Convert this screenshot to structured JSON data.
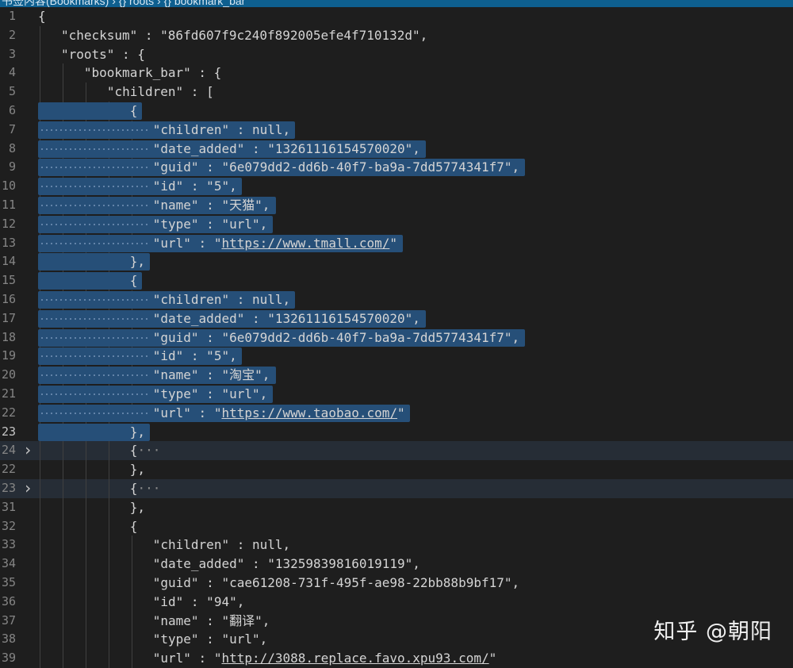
{
  "header": {
    "crumb": "书签内容(Bookmarks) › {} roots › {} bookmark_bar"
  },
  "watermark": "知乎 @朝阳",
  "lines": [
    {
      "n": "1",
      "indent": 0,
      "text": "{"
    },
    {
      "n": "2",
      "indent": 1,
      "text": "\"checksum\" : \"86fd607f9c240f892005efe4f710132d\","
    },
    {
      "n": "3",
      "indent": 1,
      "text": "\"roots\" : {"
    },
    {
      "n": "4",
      "indent": 2,
      "text": "\"bookmark_bar\" : {"
    },
    {
      "n": "5",
      "indent": 3,
      "text": "\"children\" : ["
    },
    {
      "n": "6",
      "indent": 4,
      "text": "{",
      "sel": true
    },
    {
      "n": "7",
      "indent": 5,
      "text": "\"children\" : null,",
      "sel": true
    },
    {
      "n": "8",
      "indent": 5,
      "text": "\"date_added\" : \"13261116154570020\",",
      "sel": true
    },
    {
      "n": "9",
      "indent": 5,
      "text": "\"guid\" : \"6e079dd2-dd6b-40f7-ba9a-7dd5774341f7\",",
      "sel": true
    },
    {
      "n": "10",
      "indent": 5,
      "text": "\"id\" : \"5\",",
      "sel": true
    },
    {
      "n": "11",
      "indent": 5,
      "text": "\"name\" : \"天猫\",",
      "sel": true
    },
    {
      "n": "12",
      "indent": 5,
      "text": "\"type\" : \"url\",",
      "sel": true
    },
    {
      "n": "13",
      "indent": 5,
      "text": "\"url\" : \"https://www.tmall.com/\"",
      "sel": true
    },
    {
      "n": "14",
      "indent": 4,
      "text": "},",
      "sel": true
    },
    {
      "n": "15",
      "indent": 4,
      "text": "{",
      "sel": true
    },
    {
      "n": "16",
      "indent": 5,
      "text": "\"children\" : null,",
      "sel": true
    },
    {
      "n": "17",
      "indent": 5,
      "text": "\"date_added\" : \"13261116154570020\",",
      "sel": true
    },
    {
      "n": "18",
      "indent": 5,
      "text": "\"guid\" : \"6e079dd2-dd6b-40f7-ba9a-7dd5774341f7\",",
      "sel": true
    },
    {
      "n": "19",
      "indent": 5,
      "text": "\"id\" : \"5\",",
      "sel": true
    },
    {
      "n": "20",
      "indent": 5,
      "text": "\"name\" : \"淘宝\",",
      "sel": true
    },
    {
      "n": "21",
      "indent": 5,
      "text": "\"type\" : \"url\",",
      "sel": true
    },
    {
      "n": "22",
      "indent": 5,
      "text": "\"url\" : \"https://www.taobao.com/\"",
      "sel": true
    },
    {
      "n": "23",
      "indent": 4,
      "text": "},",
      "sel": true,
      "active": true
    },
    {
      "n": "24",
      "indent": 4,
      "text": "{",
      "fold": true,
      "ellipsis": "···",
      "bg": true
    },
    {
      "n": "22",
      "indent": 4,
      "text": "},"
    },
    {
      "n": "23",
      "indent": 4,
      "text": "{",
      "fold": true,
      "ellipsis": "···",
      "bg": true
    },
    {
      "n": "31",
      "indent": 4,
      "text": "},"
    },
    {
      "n": "32",
      "indent": 4,
      "text": "{"
    },
    {
      "n": "33",
      "indent": 5,
      "text": "\"children\" : null,"
    },
    {
      "n": "34",
      "indent": 5,
      "text": "\"date_added\" : \"13259839816019119\","
    },
    {
      "n": "35",
      "indent": 5,
      "text": "\"guid\" : \"cae61208-731f-495f-ae98-22bb88b9bf17\","
    },
    {
      "n": "36",
      "indent": 5,
      "text": "\"id\" : \"94\","
    },
    {
      "n": "37",
      "indent": 5,
      "text": "\"name\" : \"翻译\","
    },
    {
      "n": "38",
      "indent": 5,
      "text": "\"type\" : \"url\","
    },
    {
      "n": "39",
      "indent": 5,
      "text": "\"url\" : \"http://3088.replace.favo.xpu93.com/\""
    }
  ]
}
